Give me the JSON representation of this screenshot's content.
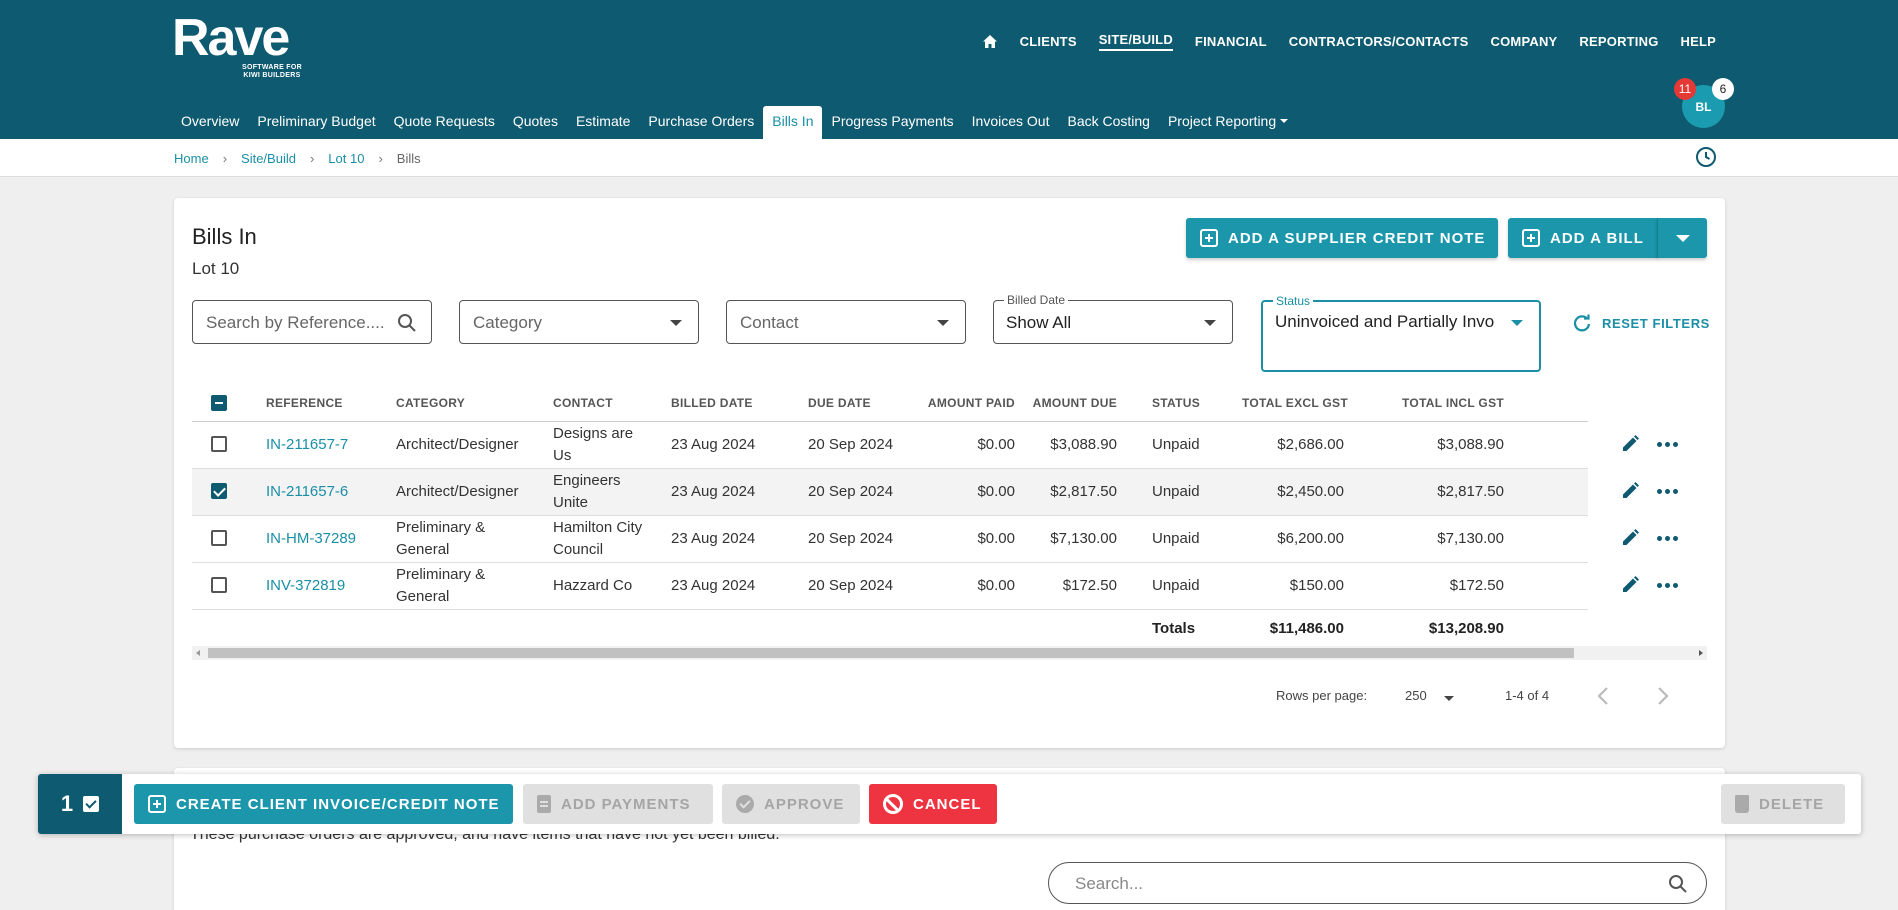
{
  "brand": {
    "name": "Rave",
    "tagline": "SOFTWARE FOR KIWI BUILDERS"
  },
  "topnav": [
    "CLIENTS",
    "SITE/BUILD",
    "FINANCIAL",
    "CONTRACTORS/CONTACTS",
    "COMPANY",
    "REPORTING",
    "HELP"
  ],
  "subnav": [
    "Overview",
    "Preliminary Budget",
    "Quote Requests",
    "Quotes",
    "Estimate",
    "Purchase Orders",
    "Bills In",
    "Progress Payments",
    "Invoices Out",
    "Back Costing",
    "Project Reporting"
  ],
  "user": {
    "initials": "BL",
    "notifications": "11",
    "messages": "6"
  },
  "breadcrumb": [
    "Home",
    "Site/Build",
    "Lot 10",
    "Bills"
  ],
  "page": {
    "title": "Bills In",
    "subtitle": "Lot 10"
  },
  "buttons": {
    "credit_note": "ADD A SUPPLIER CREDIT NOTE",
    "add_bill": "ADD A BILL",
    "reset": "RESET FILTERS"
  },
  "filters": {
    "search_placeholder": "Search by Reference....",
    "category_placeholder": "Category",
    "contact_placeholder": "Contact",
    "billed_label": "Billed Date",
    "billed_value": "Show All",
    "status_label": "Status",
    "status_value": "Uninvoiced and Partially Invo"
  },
  "table": {
    "headers": [
      "REFERENCE",
      "CATEGORY",
      "CONTACT",
      "BILLED DATE",
      "DUE DATE",
      "AMOUNT PAID",
      "AMOUNT DUE",
      "STATUS",
      "TOTAL EXCL GST",
      "TOTAL INCL GST"
    ],
    "rows": [
      {
        "ref": "IN-211657-7",
        "category": "Architect/Designer",
        "contact": "Designs are Us",
        "billed": "23 Aug 2024",
        "due": "20 Sep 2024",
        "paid": "$0.00",
        "amount_due": "$3,088.90",
        "status": "Unpaid",
        "excl": "$2,686.00",
        "incl": "$3,088.90",
        "selected": false
      },
      {
        "ref": "IN-211657-6",
        "category": "Architect/Designer",
        "contact": "Engineers Unite",
        "billed": "23 Aug 2024",
        "due": "20 Sep 2024",
        "paid": "$0.00",
        "amount_due": "$2,817.50",
        "status": "Unpaid",
        "excl": "$2,450.00",
        "incl": "$2,817.50",
        "selected": true
      },
      {
        "ref": "IN-HM-37289",
        "category": "Preliminary & General",
        "contact": "Hamilton City Council",
        "billed": "23 Aug 2024",
        "due": "20 Sep 2024",
        "paid": "$0.00",
        "amount_due": "$7,130.00",
        "status": "Unpaid",
        "excl": "$6,200.00",
        "incl": "$7,130.00",
        "selected": false
      },
      {
        "ref": "INV-372819",
        "category": "Preliminary & General",
        "contact": "Hazzard Co",
        "billed": "23 Aug 2024",
        "due": "20 Sep 2024",
        "paid": "$0.00",
        "amount_due": "$172.50",
        "status": "Unpaid",
        "excl": "$150.00",
        "incl": "$172.50",
        "selected": false
      }
    ],
    "totals_label": "Totals",
    "total_excl": "$11,486.00",
    "total_incl": "$13,208.90"
  },
  "pagination": {
    "rows_label": "Rows per page:",
    "rows_value": "250",
    "range": "1-4 of 4"
  },
  "actionbar": {
    "count": "1",
    "create": "CREATE CLIENT INVOICE/CREDIT NOTE",
    "payments": "ADD PAYMENTS",
    "approve": "APPROVE",
    "cancel": "CANCEL",
    "delete": "DELETE"
  },
  "po_section": {
    "note": "These purchase orders are approved, and have items that have not yet been billed.",
    "search_placeholder": "Search..."
  },
  "colors": {
    "header": "#0e5a70",
    "accent": "#1b96ab",
    "danger": "#ee3341"
  }
}
